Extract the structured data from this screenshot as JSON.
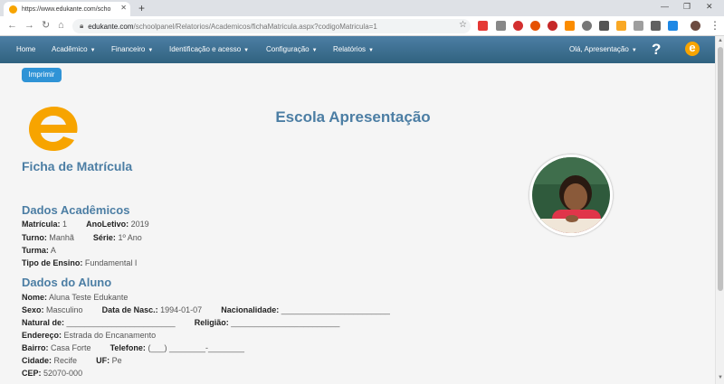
{
  "browser": {
    "tab_title": "https://www.edukante.com/scho",
    "url_domain": "edukante.com",
    "url_path": "/schoolpanel/Relatorios/Academicos/fichaMatricula.aspx?codigoMatricula=1"
  },
  "nav": {
    "items": [
      "Home",
      "Acadêmico",
      "Financeiro",
      "Identificação e acesso",
      "Configuração",
      "Relatórios"
    ],
    "user": "Olá, Apresentação",
    "help": "?",
    "logo_letter": "e"
  },
  "page": {
    "print_label": "Imprimir",
    "school_name": "Escola Apresentação",
    "form_title": "Ficha de Matrícula"
  },
  "academic": {
    "title": "Dados Acadêmicos",
    "matricula_label": "Matrícula:",
    "matricula": "1",
    "ano_label": "AnoLetivo:",
    "ano": "2019",
    "turno_label": "Turno:",
    "turno": "Manhã",
    "serie_label": "Série:",
    "serie": "1º Ano",
    "turma_label": "Turma:",
    "turma": "A",
    "ensino_label": "Tipo de Ensino:",
    "ensino": "Fundamental I"
  },
  "student": {
    "title": "Dados do Aluno",
    "nome_label": "Nome:",
    "nome": "Aluna Teste Edukante",
    "sexo_label": "Sexo:",
    "sexo": "Masculino",
    "nasc_label": "Data de Nasc.:",
    "nasc": "1994-01-07",
    "nacionalidade_label": "Nacionalidade:",
    "nacionalidade": "________________________",
    "natural_label": "Natural de:",
    "natural": "________________________",
    "religiao_label": "Religião:",
    "religiao": "________________________",
    "endereco_label": "Endereço:",
    "endereco": "Estrada do Encanamento",
    "bairro_label": "Bairro:",
    "bairro": "Casa Forte",
    "telefone_label": "Telefone:",
    "telefone": "(___) ________-________",
    "cidade_label": "Cidade:",
    "cidade": "Recife",
    "uf_label": "UF:",
    "uf": "Pe",
    "cep_label": "CEP:",
    "cep": "52070-000"
  },
  "colors": {
    "brand_blue": "#4c7ea4",
    "brand_orange": "#f7a400",
    "button_blue": "#2f93d6"
  }
}
